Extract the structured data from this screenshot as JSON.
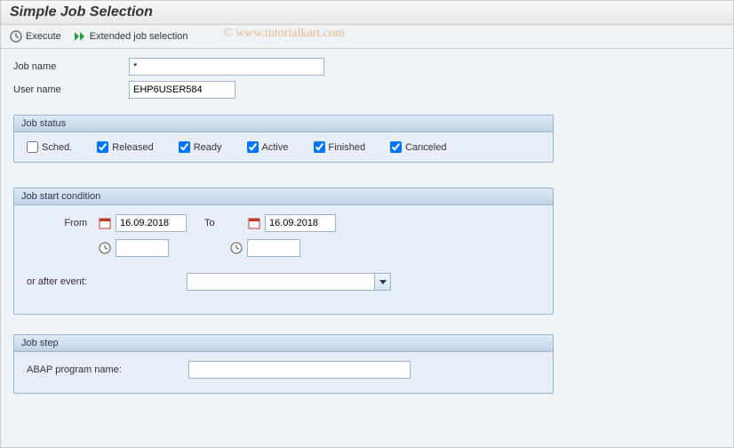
{
  "title": "Simple Job Selection",
  "toolbar": {
    "execute_label": "Execute",
    "extended_label": "Extended job selection"
  },
  "watermark": "© www.tutorialkart.com",
  "fields": {
    "job_name_label": "Job name",
    "job_name_value": "*",
    "user_name_label": "User name",
    "user_name_value": "EHP6USER584"
  },
  "status_group": {
    "title": "Job status",
    "items": {
      "sched_label": "Sched.",
      "sched_checked": false,
      "released_label": "Released",
      "released_checked": true,
      "ready_label": "Ready",
      "ready_checked": true,
      "active_label": "Active",
      "active_checked": true,
      "finished_label": "Finished",
      "finished_checked": true,
      "canceled_label": "Canceled",
      "canceled_checked": true
    }
  },
  "start_group": {
    "title": "Job start condition",
    "from_label": "From",
    "to_label": "To",
    "from_date": "16.09.2018",
    "to_date": "16.09.2018",
    "from_time": "",
    "to_time": "",
    "or_after_label": "or after event:",
    "event_value": ""
  },
  "step_group": {
    "title": "Job step",
    "abap_label": "ABAP program name:",
    "abap_value": ""
  }
}
